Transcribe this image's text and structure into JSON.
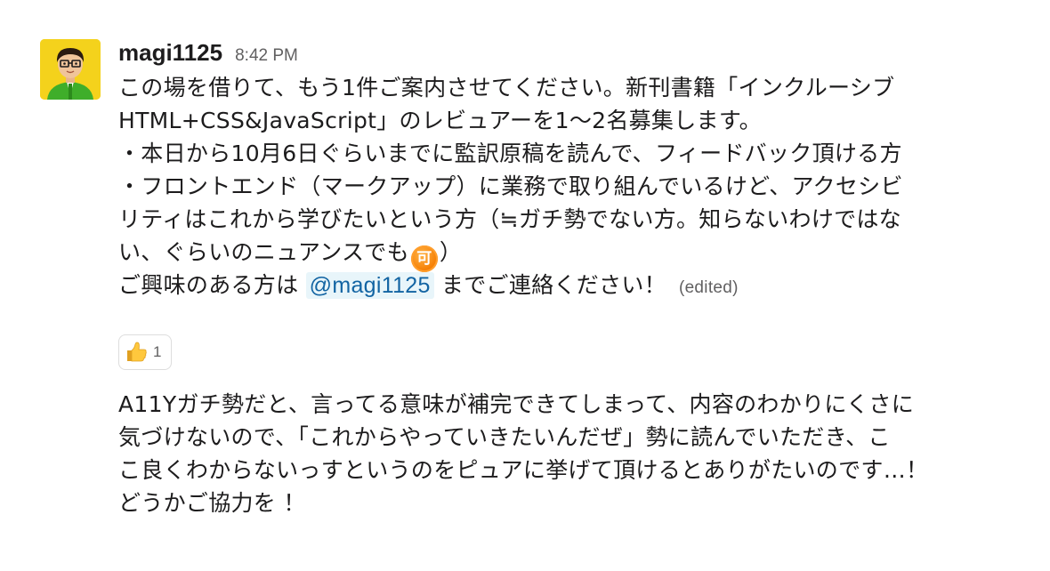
{
  "message": {
    "username": "magi1125",
    "timestamp": "8:42 PM",
    "lines": [
      "この場を借りて、もう1件ご案内させてください。新刊書籍「インクルーシブ",
      "HTML+CSS&JavaScript」のレビュアーを1〜2名募集します。",
      "・本日から10月6日ぐらいまでに監訳原稿を読んで、フィードバック頂ける方",
      "・フロントエンド（マークアップ）に業務で取り組んでいるけど、アクセシビ",
      "リティはこれから学びたいという方（≒ガチ勢でない方。知らないわけではな"
    ],
    "line6_before": "い、ぐらいのニュアンスでも",
    "line6_emoji": "可",
    "line6_after": "）",
    "line7_before": "ご興味のある方は ",
    "mention": "@magi1125",
    "line7_after": " までご連絡ください！",
    "edited": "(edited)",
    "reaction": {
      "emoji_icon": "thumbs-up-icon",
      "count": "1"
    }
  },
  "second_message": {
    "lines": [
      "A11Yガチ勢だと、言ってる意味が補完できてしまって、内容のわかりにくさに",
      "気づけないので、「これからやっていきたいんだぜ」勢に読んでいただき、こ",
      "こ良くわからないっすというのをピュアに挙げて頂けるとありがたいのです…！",
      "どうかご協力を  ！"
    ]
  }
}
